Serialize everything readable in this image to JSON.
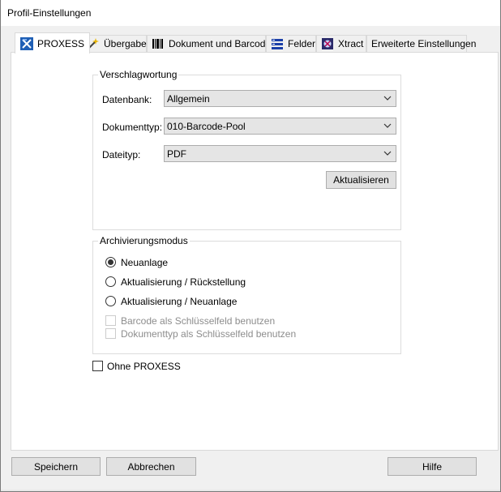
{
  "window": {
    "title": "Profil-Einstellungen"
  },
  "tabs": [
    {
      "label": "PROXESS",
      "icon": "proxess-icon"
    },
    {
      "label": "Übergabe",
      "icon": "wand-icon"
    },
    {
      "label": "Dokument und Barcode",
      "icon": "barcode-icon"
    },
    {
      "label": "Felder",
      "icon": "fields-icon"
    },
    {
      "label": "Xtract",
      "icon": "xtract-icon"
    },
    {
      "label": "Erweiterte Einstellungen"
    }
  ],
  "verschlagwortung": {
    "legend": "Verschlagwortung",
    "datenbank_label": "Datenbank:",
    "datenbank_value": "Allgemein",
    "dokumenttyp_label": "Dokumenttyp:",
    "dokumenttyp_value": "010-Barcode-Pool",
    "dateityp_label": "Dateityp:",
    "dateityp_value": "PDF",
    "refresh_label": "Aktualisieren"
  },
  "archivierung": {
    "legend": "Archivierungsmodus",
    "options": [
      {
        "label": "Neuanlage",
        "checked": true
      },
      {
        "label": "Aktualisierung / Rückstellung",
        "checked": false
      },
      {
        "label": "Aktualisierung / Neuanlage",
        "checked": false
      }
    ],
    "checkboxes": [
      {
        "label": "Barcode als Schlüsselfeld benutzen",
        "enabled": false
      },
      {
        "label": "Dokumenttyp als Schlüsselfeld benutzen",
        "enabled": false
      }
    ]
  },
  "ohne_proxess_label": "Ohne PROXESS",
  "buttons": {
    "save": "Speichern",
    "cancel": "Abbrechen",
    "help": "Hilfe"
  }
}
